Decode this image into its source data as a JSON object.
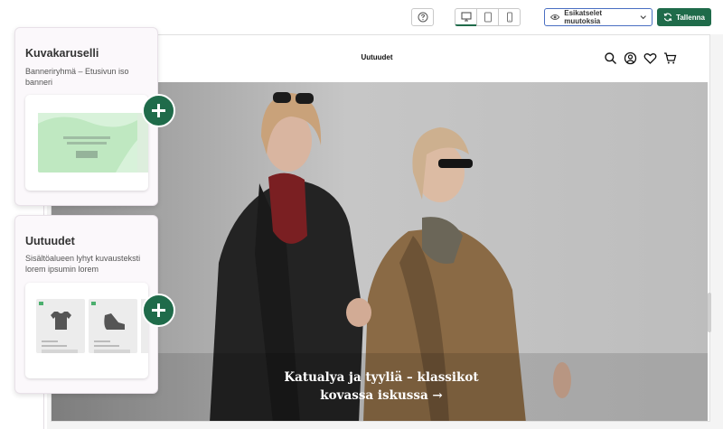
{
  "toolbar": {
    "help_icon": "question-circle-icon",
    "devices": [
      "desktop-icon",
      "tablet-icon",
      "mobile-icon"
    ],
    "preview_label": "Esikatselet muutoksia",
    "save_label": "Tallenna",
    "accent": "#1f6b4a",
    "preview_border": "#4a6fc2"
  },
  "store": {
    "title": "Uutuudet",
    "icons": [
      "search-icon",
      "account-icon",
      "heart-icon",
      "cart-icon"
    ],
    "hero_caption": "Katualya ja tyyliä – klassikot kovassa iskussa →"
  },
  "cards": [
    {
      "title": "Kuvakaruselli",
      "desc": "Banneriryhmä – Etusivun iso banneri"
    },
    {
      "title": "Uutuudet",
      "desc": "Sisältöalueen lyhyt kuvausteksti lorem ipsumin lorem"
    }
  ]
}
